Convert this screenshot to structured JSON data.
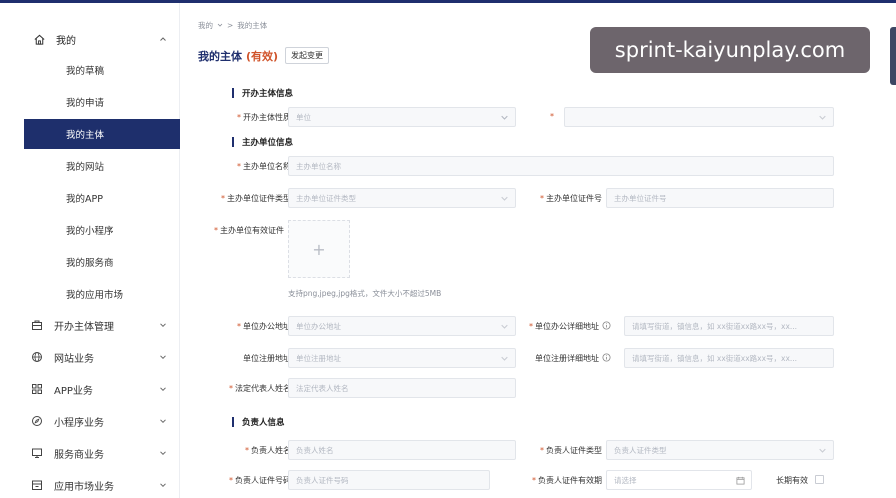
{
  "sidebar": {
    "top": {
      "label": "我的",
      "icon": "home-icon"
    },
    "subitems": [
      "我的草稿",
      "我的申请",
      "我的主体",
      "我的网站",
      "我的APP",
      "我的小程序",
      "我的服务商",
      "我的应用市场"
    ],
    "active_index": 2,
    "groups": [
      {
        "label": "开办主体管理",
        "icon": "building-icon"
      },
      {
        "label": "网站业务",
        "icon": "globe-icon"
      },
      {
        "label": "APP业务",
        "icon": "app-grid-icon"
      },
      {
        "label": "小程序业务",
        "icon": "compass-icon"
      },
      {
        "label": "服务商业务",
        "icon": "monitor-icon"
      },
      {
        "label": "应用市场业务",
        "icon": "store-icon"
      }
    ]
  },
  "breadcrumb": {
    "root": "我的",
    "sep": ">",
    "current": "我的主体"
  },
  "page": {
    "title": "我的主体",
    "status": "(有效)",
    "change_button": "发起变更"
  },
  "sections": {
    "organizer": "开办主体信息",
    "unit": "主办单位信息",
    "person": "负责人信息"
  },
  "fields": {
    "org_nature": {
      "label": "开办主体性质",
      "placeholder": "单位"
    },
    "unit_name": {
      "label": "主办单位名称",
      "placeholder": "主办单位名称"
    },
    "unit_cert_type": {
      "label": "主办单位证件类型",
      "placeholder": "主办单位证件类型"
    },
    "unit_cert_no": {
      "label": "主办单位证件号",
      "placeholder": "主办单位证件号"
    },
    "unit_valid_cert": {
      "label": "主办单位有效证件"
    },
    "upload_hint": "支持png,jpeg,jpg格式，文件大小不超过5MB",
    "office_addr": {
      "label": "单位办公地址",
      "placeholder": "单位办公地址"
    },
    "office_detail": {
      "label": "单位办公详细地址",
      "placeholder": "请填写街道，镇信息，如 xx街道xx路xx号，xx..."
    },
    "reg_addr": {
      "label": "单位注册地址",
      "placeholder": "单位注册地址"
    },
    "reg_detail": {
      "label": "单位注册详细地址",
      "placeholder": "请填写街道，镇信息，如 xx街道xx路xx号，xx..."
    },
    "legal_rep": {
      "label": "法定代表人姓名",
      "placeholder": "法定代表人姓名"
    },
    "person_name": {
      "label": "负责人姓名",
      "placeholder": "负责人姓名"
    },
    "person_cert_type": {
      "label": "负责人证件类型",
      "placeholder": "负责人证件类型"
    },
    "person_cert_no": {
      "label": "负责人证件号码",
      "placeholder": "负责人证件号码"
    },
    "person_cert_valid": {
      "label": "负责人证件有效期",
      "placeholder": "请选择"
    },
    "long_term": {
      "label": "长期有效"
    }
  },
  "watermark": "sprint-kaiyunplay.com",
  "colors": {
    "primary": "#1e2f6c",
    "required": "#d0542b",
    "valid_status": "#d0542b"
  }
}
